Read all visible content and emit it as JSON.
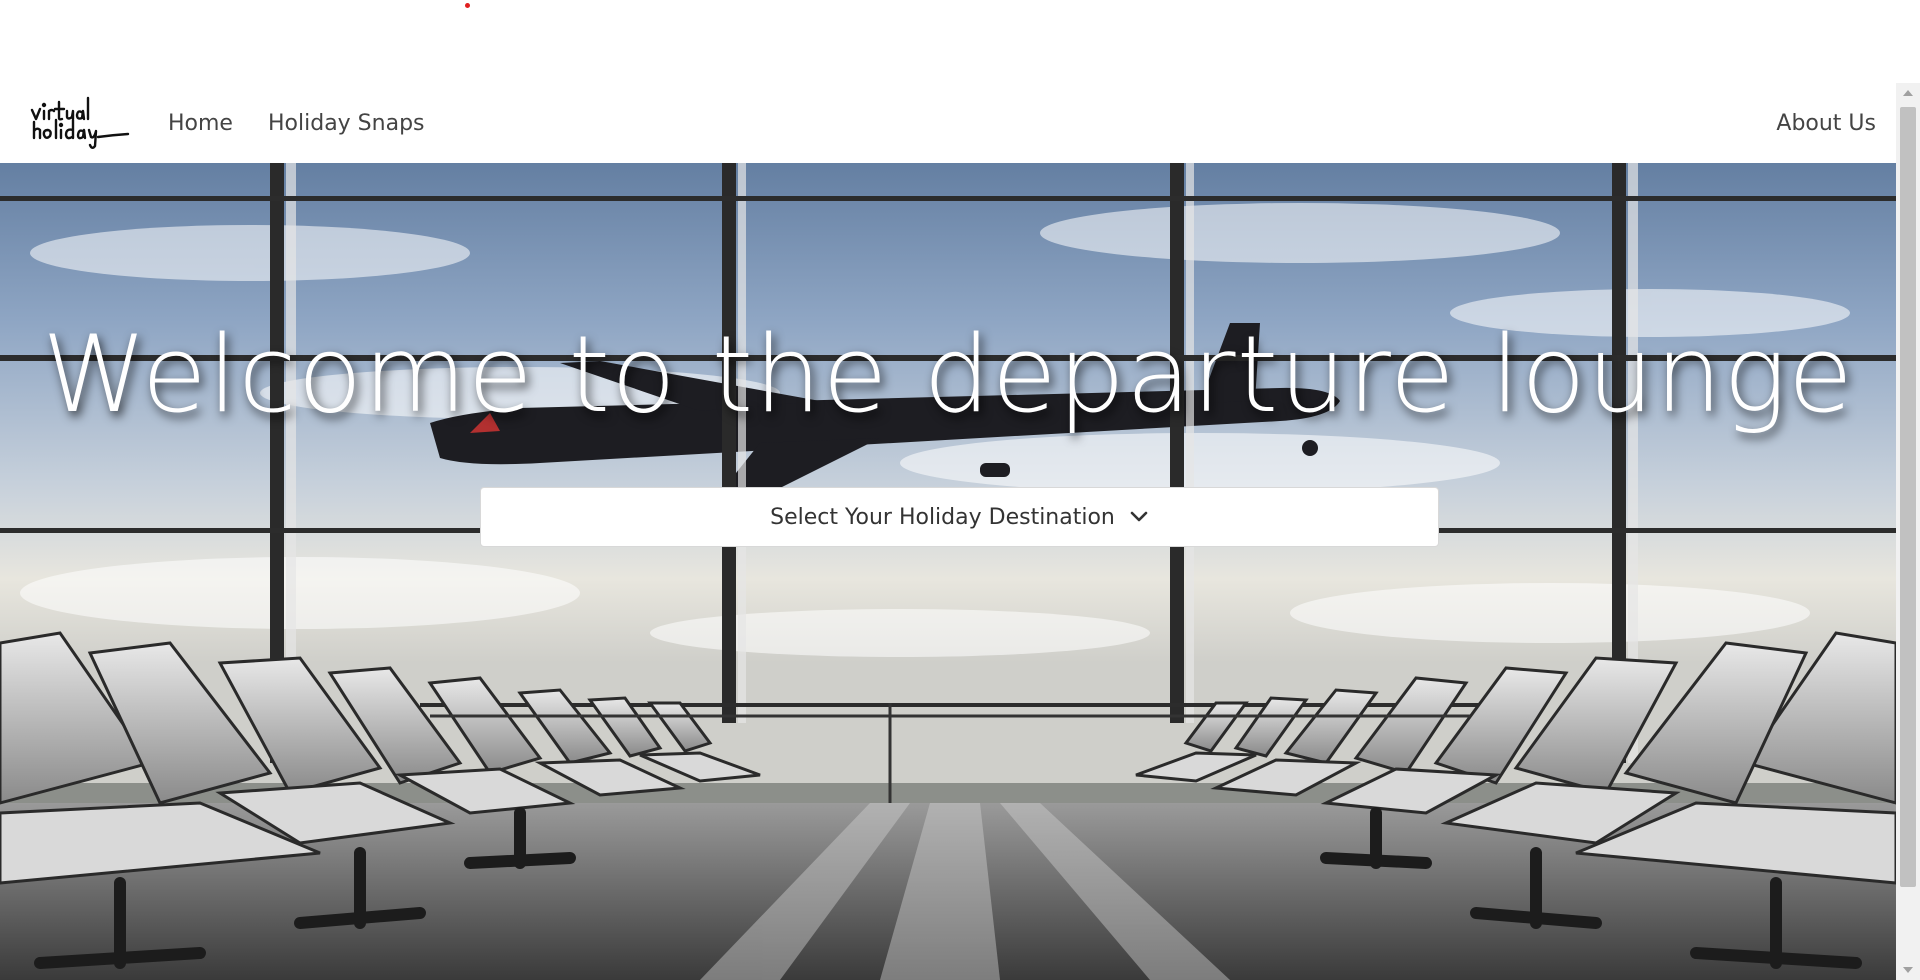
{
  "logo": {
    "text": "virtual holiday"
  },
  "nav": {
    "home_label": "Home",
    "snaps_label": "Holiday Snaps",
    "about_label": "About Us"
  },
  "hero": {
    "title": "Welcome to the departure lounge",
    "background": "airport-departure-lounge-with-airplane-photo"
  },
  "destination_select": {
    "label": "Select Your Holiday Destination",
    "icon": "chevron-down-icon"
  },
  "colors": {
    "nav_text": "#444444",
    "hero_title": "#ffffff",
    "dropdown_bg": "#ffffff"
  }
}
